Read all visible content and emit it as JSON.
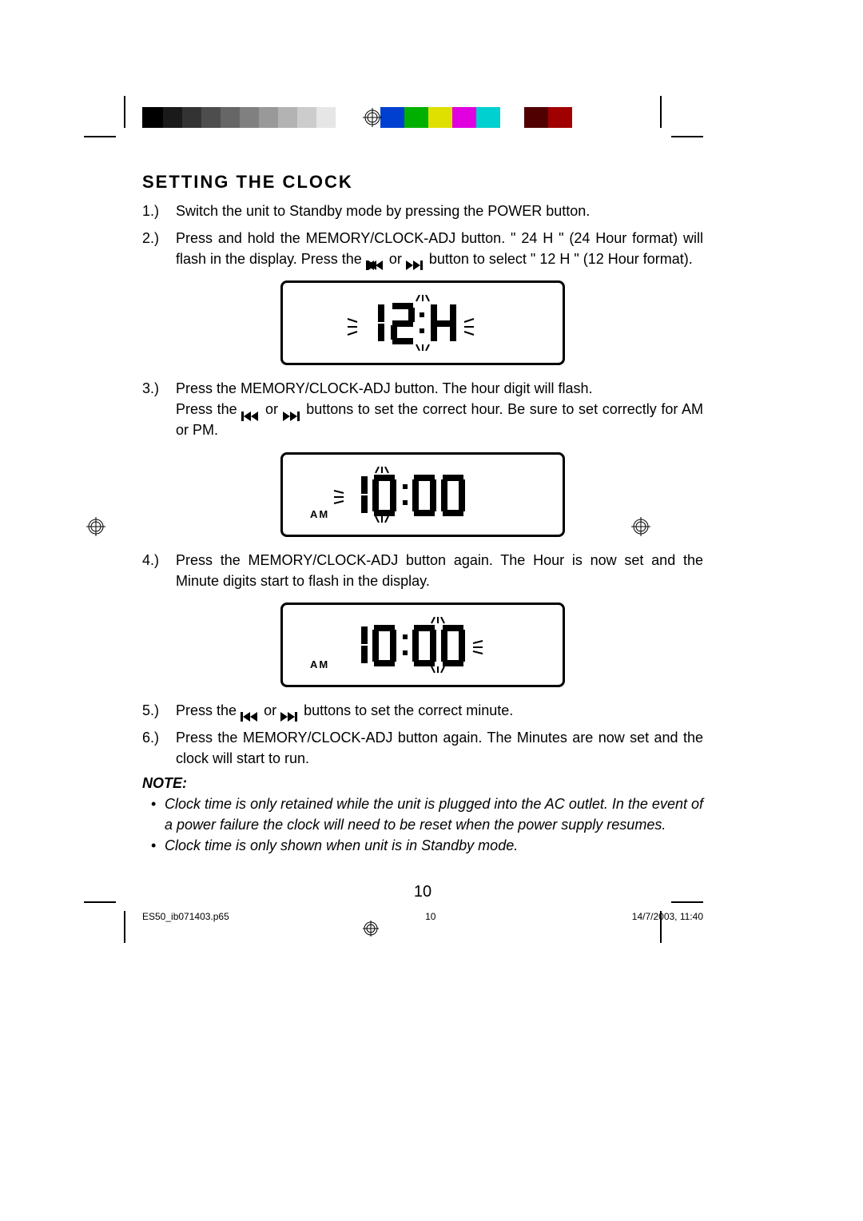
{
  "title": "SETTING THE CLOCK",
  "steps": {
    "s1": {
      "n": "1.)",
      "t": "Switch the unit to Standby mode by pressing the POWER button."
    },
    "s2": {
      "n": "2.)",
      "t1": "Press and hold the MEMORY/CLOCK-ADJ button. \" 24 H \" (24 Hour format) will flash in the display. Press the ",
      "t2": " or ",
      "t3": " button to select \" 12 H \" (12 Hour format)."
    },
    "s3": {
      "n": "3.)",
      "t1": "Press the MEMORY/CLOCK-ADJ button. The hour digit will flash.",
      "t2": "Press the ",
      "t3": " or ",
      "t4": " buttons to set the correct hour. Be sure to set correctly for AM or PM."
    },
    "s4": {
      "n": "4.)",
      "t": "Press the MEMORY/CLOCK-ADJ button again. The Hour is now set and the Minute digits start to flash in the display."
    },
    "s5": {
      "n": "5.)",
      "t1": "Press the ",
      "t2": " or ",
      "t3": " buttons to set the correct minute."
    },
    "s6": {
      "n": "6.)",
      "t": "Press the MEMORY/CLOCK-ADJ button again. The Minutes are now set and the clock will start to run."
    }
  },
  "display1": {
    "text": "12:H"
  },
  "display2": {
    "text": "10:00",
    "meridiem": "AM"
  },
  "display3": {
    "text": "10:00",
    "meridiem": "AM"
  },
  "note": {
    "header": "NOTE:",
    "n1": "Clock time is only retained while the unit is plugged into the AC outlet. In the event of a power failure the clock will need to be reset when the power supply resumes.",
    "n2": "Clock time is only shown when unit is in Standby mode."
  },
  "page_number": "10",
  "slug": {
    "file": "ES50_ib071403.p65",
    "page": "10",
    "date": "14/7/2003, 11:40"
  },
  "calib_colors": [
    "#000000",
    "#1a1a1a",
    "#333333",
    "#4d4d4d",
    "#666666",
    "#808080",
    "#999999",
    "#b3b3b3",
    "#cccccc",
    "#e6e6e6",
    "#ffffff",
    "#00a0a0",
    "#0000c0",
    "#00a000",
    "#c000c0",
    "#c00000",
    "#c0c000",
    "#ffffff",
    "#400000",
    "#004000",
    "#000040"
  ]
}
